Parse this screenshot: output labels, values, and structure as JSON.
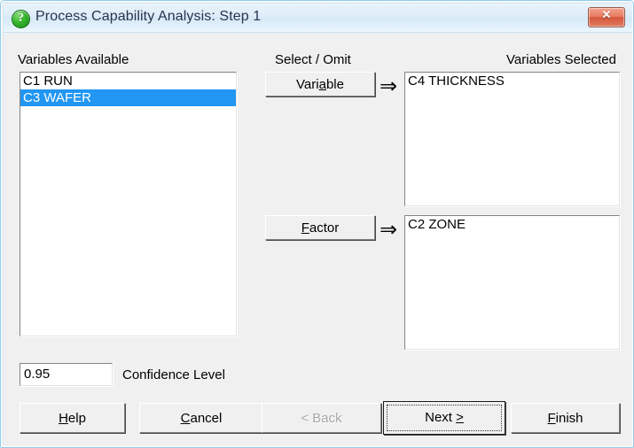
{
  "window": {
    "title": "Process Capability Analysis: Step 1",
    "icon": "question-mark-icon",
    "icon_glyph": "?",
    "close_glyph": "✕",
    "accent_title_color": "#26344e",
    "close_button_color": "#d4563c",
    "selection_color": "#2196f3"
  },
  "left_panel": {
    "header": "Variables Available",
    "items": [
      {
        "label": "C1 RUN",
        "selected": false
      },
      {
        "label": "C3 WAFER",
        "selected": true
      }
    ]
  },
  "middle_panel": {
    "header": "Select / Omit",
    "variable_button": {
      "label": "Variable",
      "mnemonic": "a"
    },
    "factor_button": {
      "label": "Factor",
      "mnemonic": "F"
    },
    "arrow_glyph": "⇒"
  },
  "right_panel": {
    "header": "Variables Selected",
    "variables_selected": [
      "C4 THICKNESS"
    ],
    "factors_selected": [
      "C2 ZONE"
    ]
  },
  "confidence": {
    "value": "0.95",
    "label": "Confidence Level"
  },
  "footer": {
    "buttons": [
      {
        "name": "help",
        "label": "Help",
        "mnemonic": "H",
        "disabled": false,
        "default": false
      },
      {
        "name": "cancel",
        "label": "Cancel",
        "mnemonic": "C",
        "disabled": false,
        "default": false
      },
      {
        "name": "back",
        "label": "< Back",
        "mnemonic": "<",
        "disabled": true,
        "default": false
      },
      {
        "name": "next",
        "label": "Next >",
        "mnemonic": ">",
        "disabled": false,
        "default": true
      },
      {
        "name": "finish",
        "label": "Finish",
        "mnemonic": "F",
        "disabled": false,
        "default": false
      }
    ]
  }
}
